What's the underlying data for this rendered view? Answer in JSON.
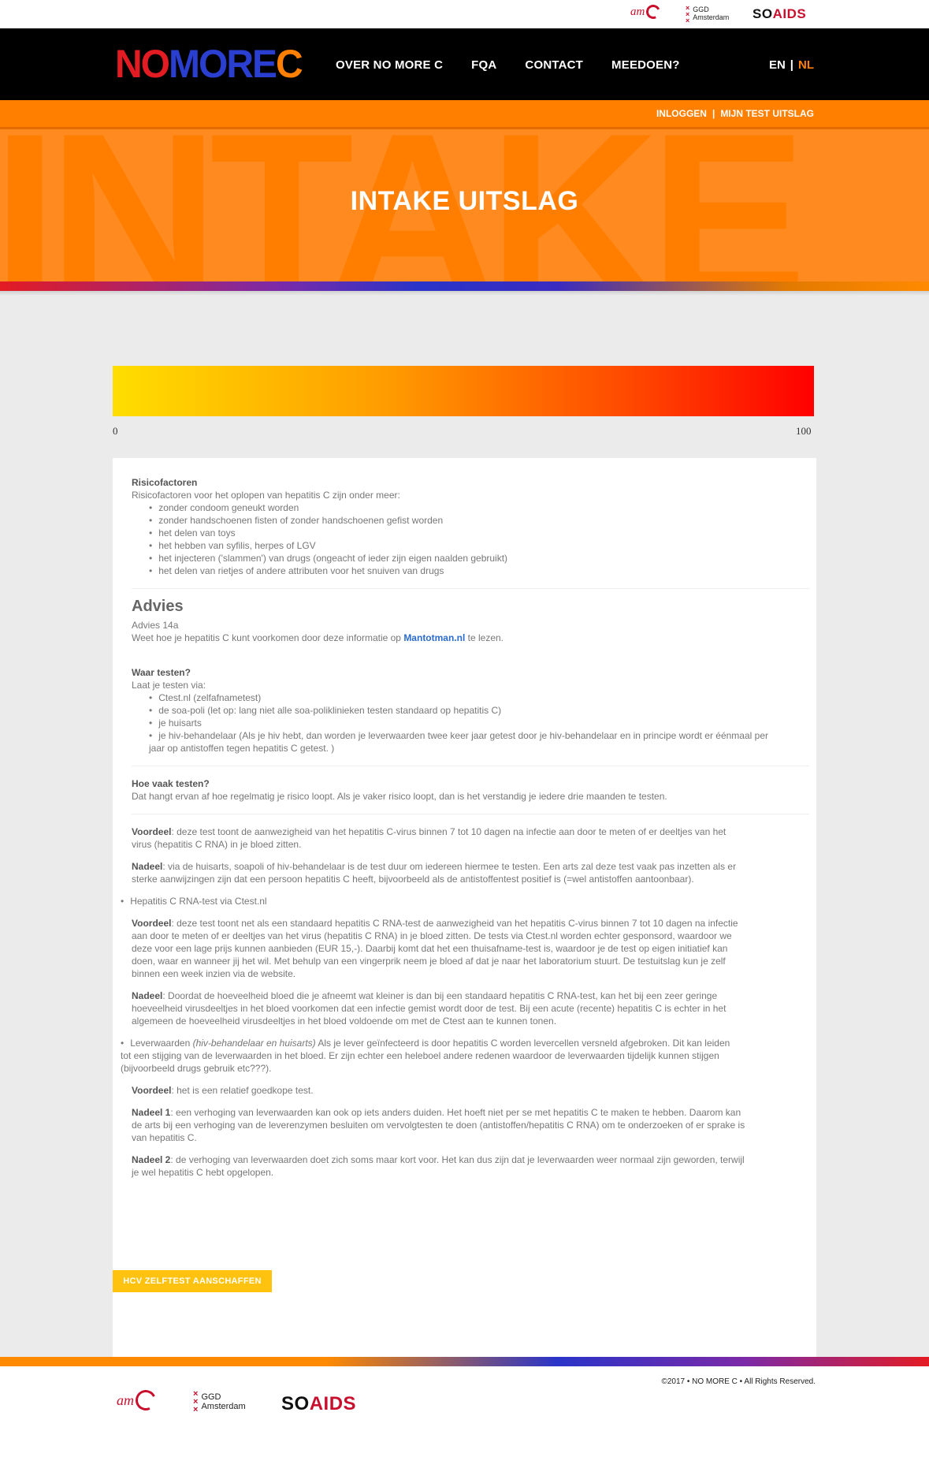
{
  "partners": {
    "amc": "am",
    "ggd_line1": "GGD",
    "ggd_line2": "Amsterdam",
    "so": "SO",
    "aids": "AIDS"
  },
  "header": {
    "logo": {
      "no": "NO",
      "more": "MORE",
      "c": "C"
    },
    "nav": [
      "OVER NO MORE C",
      "FQA",
      "CONTACT",
      "MEEDOEN?"
    ],
    "lang": {
      "en": "EN",
      "sep": "|",
      "nl": "NL"
    }
  },
  "subbar": {
    "login": "INLOGGEN",
    "sep": "|",
    "result": "MIJN TEST UITSLAG"
  },
  "hero": {
    "title": "INTAKE UITSLAG",
    "bg": "INTAKE"
  },
  "score": {
    "min": "0",
    "max": "100"
  },
  "content": {
    "risk_title": "Risicofactoren",
    "risk_intro": "Risicofactoren voor het oplopen van hepatitis C zijn onder meer:",
    "risk_items": [
      "zonder condoom geneukt worden",
      "zonder handschoenen fisten of zonder handschoenen gefist worden",
      "het delen van toys",
      "het hebben van syfilis, herpes of LGV",
      "het injecteren ('slammen') van drugs (ongeacht of ieder zijn eigen naalden gebruikt)",
      "het delen van rietjes of andere attributen voor het snuiven van drugs"
    ],
    "advies_title": "Advies",
    "advies_code": "Advies 14a",
    "advies_text_pre": "Weet hoe je hepatitis C kunt voorkomen door deze informatie op ",
    "advies_link": "Mantotman.nl",
    "advies_text_post": " te lezen.",
    "waar_title": "Waar testen?",
    "waar_intro": "Laat je testen via:",
    "waar_items": [
      "Ctest.nl (zelfafnametest)",
      "de soa-poli (let op: lang niet alle soa-poliklinieken testen standaard op hepatitis C)",
      "je huisarts",
      "je hiv-behandelaar (Als je hiv hebt, dan worden je leverwaarden twee keer jaar getest door je hiv-behandelaar en in principe wordt er éénmaal per jaar op antistoffen tegen hepatitis C getest. )"
    ],
    "vaak_title": "Hoe vaak testen?",
    "vaak_text": "Dat hangt ervan af hoe regelmatig je risico loopt. Als je vaker risico loopt, dan is het verstandig je iedere drie maanden te testen.",
    "voordeel_label": "Voordeel",
    "nadeel_label": "Nadeel",
    "nadeel1_label": "Nadeel 1",
    "nadeel2_label": "Nadeel 2",
    "voordeel1": ": deze test toont de aanwezigheid van het hepatitis C-virus binnen 7 tot 10 dagen na infectie aan door te meten of er deeltjes van het virus (hepatitis C RNA) in je bloed zitten.",
    "nadeel1": ": via de huisarts, soapoli of hiv-behandelaar is de test duur om iedereen hiermee te testen. Een arts zal deze test vaak pas inzetten als er sterke aanwijzingen zijn dat een persoon hepatitis C heeft, bijvoorbeeld als de antistoffentest positief is (=wel antistoffen aantoonbaar).",
    "bullet_ctest": "Hepatitis C RNA-test via Ctest.nl",
    "voordeel2": ": deze test toont net als een standaard hepatitis C RNA-test de aanwezigheid van het hepatitis C-virus binnen 7 tot 10 dagen na infectie aan door te meten of er deeltjes van het virus (hepatitis C RNA) in je bloed zitten. De tests via Ctest.nl worden echter gesponsord, waardoor we deze voor een lage prijs kunnen aanbieden (EUR 15,-). Daarbij komt dat het een thuisafname-test is, waardoor je de test op eigen initiatief kan doen, waar en wanneer jij het wil. Met behulp van een vingerprik neem je bloed af dat je naar het laboratorium stuurt. De testuitslag kun je zelf binnen een week inzien via de website.",
    "nadeel2": ": Doordat de hoeveelheid bloed die je afneemt wat kleiner is dan bij een standaard hepatitis C RNA-test, kan het bij een zeer geringe hoeveelheid virusdeeltjes in het bloed voorkomen dat een infectie  gemist wordt door de test. Bij een acute (recente) hepatitis C is echter in het algemeen de hoeveelheid virusdeeltjes in het bloed voldoende om met de Ctest aan te kunnen tonen.",
    "bullet_lever_pre": "Leverwaarden ",
    "bullet_lever_em": "(hiv-behandelaar en huisarts)",
    "bullet_lever_post": " Als je lever geïnfecteerd is door hepatitis C worden levercellen versneld afgebroken. Dit kan leiden tot een stijging van de leverwaarden in het bloed. Er zijn echter een heleboel andere redenen waardoor de leverwaarden tijdelijk kunnen stijgen (bijvoorbeeld drugs gebruik etc???).",
    "voordeel3": ": het is een relatief goedkope test.",
    "nadeel3": ": een verhoging van leverwaarden kan ook op iets anders duiden. Het hoeft niet per se met hepatitis C te maken te hebben. Daarom kan de arts bij een verhoging van de leverenzymen besluiten om vervolgtesten te doen (antistoffen/hepatitis C RNA) om te onderzoeken of er sprake is van hepatitis C.",
    "nadeel4": ": de verhoging van leverwaarden doet zich soms maar kort voor. Het kan dus zijn dat je leverwaarden weer normaal zijn geworden, terwijl je wel hepatitis C hebt opgelopen."
  },
  "button": "HCV ZELFTEST AANSCHAFFEN",
  "footer": {
    "copyright": "©2017 • NO MORE C  • All Rights Reserved."
  }
}
